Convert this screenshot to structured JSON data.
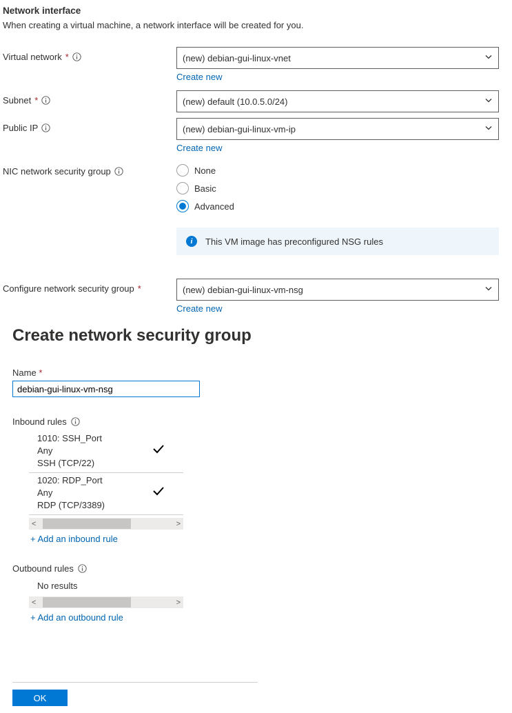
{
  "header": {
    "title": "Network interface",
    "description": "When creating a virtual machine, a network interface will be created for you."
  },
  "virtualNetwork": {
    "label": "Virtual network",
    "value": "(new) debian-gui-linux-vnet",
    "createNew": "Create new"
  },
  "subnet": {
    "label": "Subnet",
    "value": "(new) default (10.0.5.0/24)"
  },
  "publicIp": {
    "label": "Public IP",
    "value": "(new) debian-gui-linux-vm-ip",
    "createNew": "Create new"
  },
  "nicNsg": {
    "label": "NIC network security group",
    "options": [
      "None",
      "Basic",
      "Advanced"
    ],
    "selectedIndex": 2
  },
  "banner": {
    "text": "This VM image has preconfigured NSG rules"
  },
  "configureNsg": {
    "label": "Configure network security group",
    "value": "(new) debian-gui-linux-vm-nsg",
    "createNew": "Create new"
  },
  "createNsgPanel": {
    "title": "Create network security group",
    "nameLabel": "Name",
    "nameValue": "debian-gui-linux-vm-nsg",
    "inboundLabel": "Inbound rules",
    "outboundLabel": "Outbound rules",
    "inboundRules": [
      {
        "priority": "1010: SSH_Port",
        "source": "Any",
        "service": "SSH (TCP/22)"
      },
      {
        "priority": "1020: RDP_Port",
        "source": "Any",
        "service": "RDP (TCP/3389)"
      }
    ],
    "outboundRules": [],
    "noResults": "No results",
    "addInbound": "+ Add an inbound rule",
    "addOutbound": "+ Add an outbound rule",
    "okLabel": "OK"
  }
}
